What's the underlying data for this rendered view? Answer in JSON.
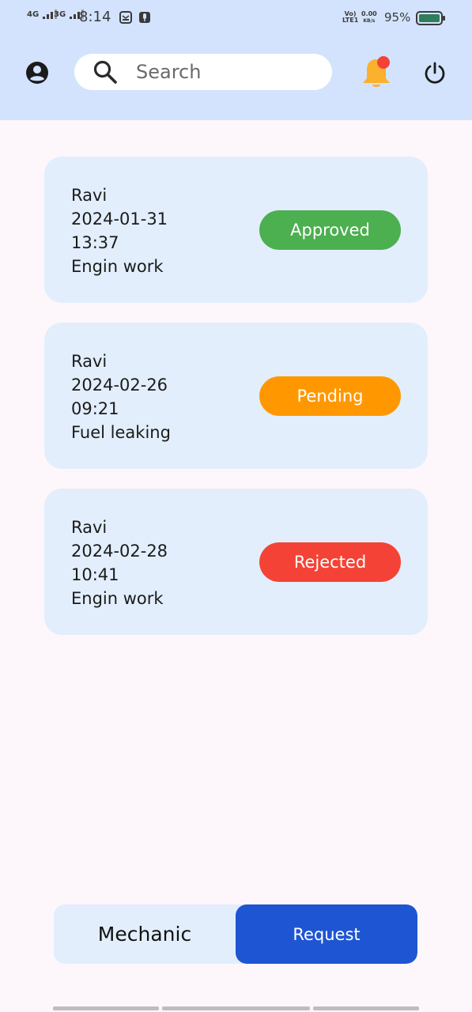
{
  "status_bar": {
    "network1": "4G",
    "network2": "3G",
    "time": "8:14",
    "volte_top": "Vo)",
    "volte_bottom": "LTE1",
    "speed_value": "0.00",
    "speed_unit": "KB/s",
    "battery_percent": "95%"
  },
  "app_bar": {
    "search_placeholder": "Search",
    "search_value": ""
  },
  "requests": [
    {
      "name": "Ravi",
      "date": "2024-01-31",
      "time": "13:37",
      "description": "Engin work",
      "status": "Approved",
      "status_color": "#4CAF50"
    },
    {
      "name": "Ravi",
      "date": "2024-02-26",
      "time": "09:21",
      "description": "Fuel leaking",
      "status": "Pending",
      "status_color": "#FF9800"
    },
    {
      "name": "Ravi",
      "date": "2024-02-28",
      "time": "10:41",
      "description": "Engin work",
      "status": "Rejected",
      "status_color": "#F44336"
    }
  ],
  "bottom_tabs": {
    "mechanic_label": "Mechanic",
    "request_label": "Request",
    "selected": "Request",
    "selected_color": "#1E55D3"
  },
  "colors": {
    "header_bg": "#D3E3FD",
    "card_bg": "#E2EEFC",
    "page_bg": "#FDF7FB",
    "notification_bell": "#FBB12D",
    "notification_dot": "#F44336"
  }
}
